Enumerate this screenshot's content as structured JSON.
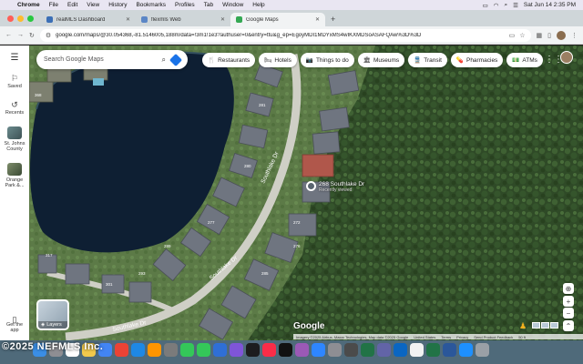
{
  "menubar": {
    "app": "Chrome",
    "items": [
      "File",
      "Edit",
      "View",
      "History",
      "Bookmarks",
      "Profiles",
      "Tab",
      "Window",
      "Help"
    ],
    "clock": "Sat Jun 14  2:35 PM"
  },
  "tabs": [
    {
      "title": "realMLS Dashboard",
      "favicon_color": "#3b6fb6"
    },
    {
      "title": "flexmls Web",
      "favicon_color": "#5b86c6"
    },
    {
      "title": "Google Maps",
      "favicon_color": "#34a853"
    }
  ],
  "toolbar": {
    "url": "google.com/maps/@30.054368,-81.5146005,188m/data=!3m1!1e3?authuser=0&entry=ttu&g_ep=EgoyMDI1MDYxMS4wIKXMDSoASAFQAw%3D%3D"
  },
  "rail": {
    "saved": "Saved",
    "recents": "Recents",
    "places": [
      {
        "label": "St. Johns County"
      },
      {
        "label": "Orange Park &..."
      }
    ],
    "get_app": "Get the app"
  },
  "search": {
    "placeholder": "Search Google Maps"
  },
  "chips": [
    {
      "label": "Restaurants",
      "icon": "fork-knife-icon",
      "glyph": "🍴"
    },
    {
      "label": "Hotels",
      "icon": "bed-icon",
      "glyph": "🛏"
    },
    {
      "label": "Things to do",
      "icon": "camera-icon",
      "glyph": "📷"
    },
    {
      "label": "Museums",
      "icon": "museum-icon",
      "glyph": "🏛"
    },
    {
      "label": "Transit",
      "icon": "train-icon",
      "glyph": "🚆"
    },
    {
      "label": "Pharmacies",
      "icon": "pill-icon",
      "glyph": "💊"
    },
    {
      "label": "ATMs",
      "icon": "cash-icon",
      "glyph": "💵"
    }
  ],
  "map": {
    "pin_title": "268 Southlake Dr",
    "pin_subtitle": "Recently viewed",
    "layers_label": "Layers",
    "logo": "Google",
    "attribution": "Imagery ©2025 Airbus, Maxar Technologies, Map data ©2025 Google",
    "footer_links": [
      "United States",
      "Terms",
      "Privacy",
      "Send Product Feedback"
    ],
    "scale": "50 ft",
    "street_labels": [
      "Southlake Dr",
      "Southlake Dr",
      "Southlake Dr"
    ],
    "house_numbers": [
      "368",
      "281",
      "280",
      "276",
      "272",
      "277",
      "285",
      "293",
      "301",
      "289",
      "317"
    ]
  },
  "watermark": "©2025 NEFMLS Inc."
}
